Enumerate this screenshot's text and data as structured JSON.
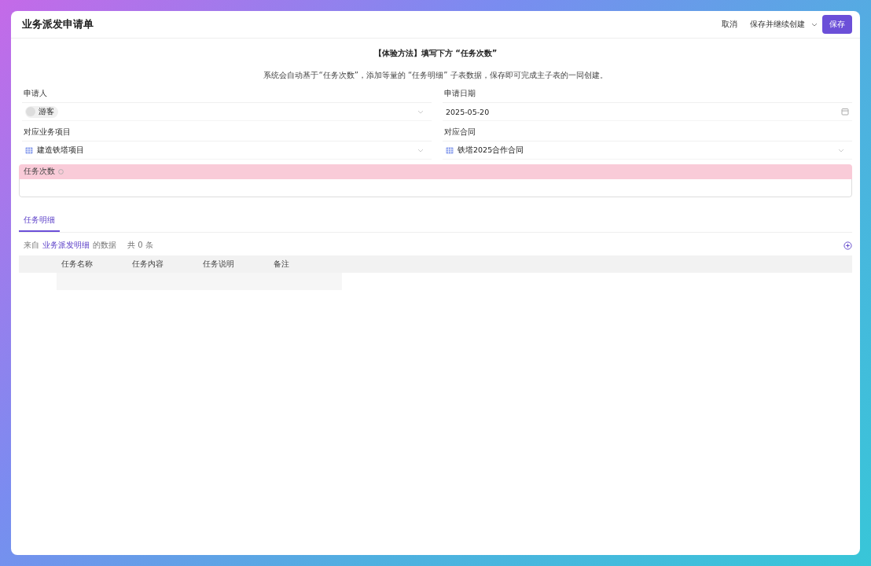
{
  "header": {
    "title": "业务派发申请单",
    "cancel": "取消",
    "save_continue": "保存并继续创建",
    "save": "保存"
  },
  "notice": {
    "title": "【体验方法】填写下方 “任务次数”",
    "text": "系统会自动基于“任务次数”，添加等量的 “任务明细” 子表数据，保存即可完成主子表的一同创建。"
  },
  "fields": [
    {
      "label": "申请人",
      "kind": "user",
      "value": "游客"
    },
    {
      "label": "申请日期",
      "kind": "date",
      "value": "2025-05-20"
    },
    {
      "label": "对应业务项目",
      "kind": "record",
      "value": "建造铁塔项目"
    },
    {
      "label": "对应合同",
      "kind": "record",
      "value": "铁塔2025合作合同"
    }
  ],
  "count_field": {
    "label": "任务次数",
    "highlighted": true
  },
  "tabs": [
    {
      "label": "任务明细",
      "selected": true
    }
  ],
  "subtable": {
    "prefix": "来自",
    "source": "业务派发明细",
    "suffix": "的数据",
    "total": "共 0 条",
    "columns": [
      "任务名称",
      "任务内容",
      "任务说明",
      "备注"
    ]
  }
}
